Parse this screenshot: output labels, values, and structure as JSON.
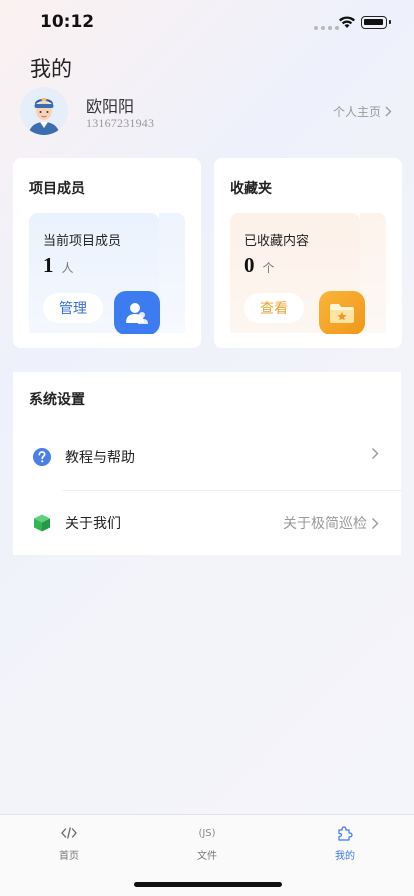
{
  "status_bar": {
    "time": "10:12"
  },
  "page": {
    "title": "我的"
  },
  "profile": {
    "name": "欧阳阳",
    "phone": "13167231943",
    "home_link": "个人主页"
  },
  "project_card": {
    "title": "项目成员",
    "label": "当前项目成员",
    "count": "1",
    "unit": "人",
    "button": "管理",
    "accent": "#3d7cf0"
  },
  "favorites_card": {
    "title": "收藏夹",
    "label": "已收藏内容",
    "count": "0",
    "unit": "个",
    "button": "查看",
    "accent": "#f29618"
  },
  "settings": {
    "title": "系统设置",
    "items": [
      {
        "label": "教程与帮助",
        "value": "",
        "icon": "question-icon"
      },
      {
        "label": "关于我们",
        "value": "关于极简巡检",
        "icon": "cube-icon"
      }
    ]
  },
  "tabbar": {
    "items": [
      {
        "label": "首页",
        "icon": "code-icon",
        "active": false
      },
      {
        "label": "文件",
        "icon_text": "(JS)",
        "icon": "js-icon",
        "active": false
      },
      {
        "label": "我的",
        "icon": "puzzle-icon",
        "active": true
      }
    ],
    "active_color": "#3a7bf0"
  }
}
